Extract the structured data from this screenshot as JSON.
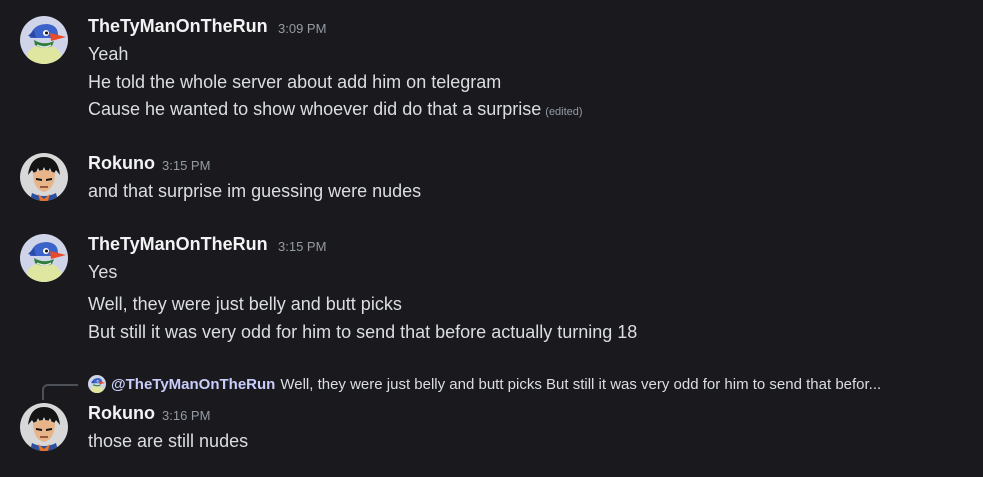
{
  "messages": [
    {
      "username": "TheTyManOnTheRun",
      "time": "3:09 PM",
      "avatar": "blue-bird-avatar",
      "lines": [
        "Yeah",
        "He told the whole server about add him on telegram",
        "Cause he wanted to show whoever did do that a surprise"
      ],
      "edited_label": "(edited)"
    },
    {
      "username": "Rokuno",
      "time": "3:15 PM",
      "avatar": "anime-character-avatar",
      "lines": [
        "and that surprise im guessing were nudes"
      ]
    },
    {
      "username": "TheTyManOnTheRun",
      "time": "3:15 PM",
      "avatar": "blue-bird-avatar",
      "lines": [
        "Yes",
        "Well, they were just belly and butt picks",
        "But still it was very odd for him to send that before actually turning 18"
      ]
    },
    {
      "reply": {
        "mention": "@TheTyManOnTheRun",
        "text": "Well, they were just belly and butt picks But still it was very odd for him to send that befor..."
      },
      "username": "Rokuno",
      "time": "3:16 PM",
      "avatar": "anime-character-avatar",
      "lines": [
        "those are still nudes"
      ]
    }
  ],
  "colors": {
    "background": "#1a1a1e",
    "username": "#f2f3f5",
    "message_text": "#dbdee1",
    "timestamp": "#949ba4",
    "mention": "#c9cdfb"
  }
}
